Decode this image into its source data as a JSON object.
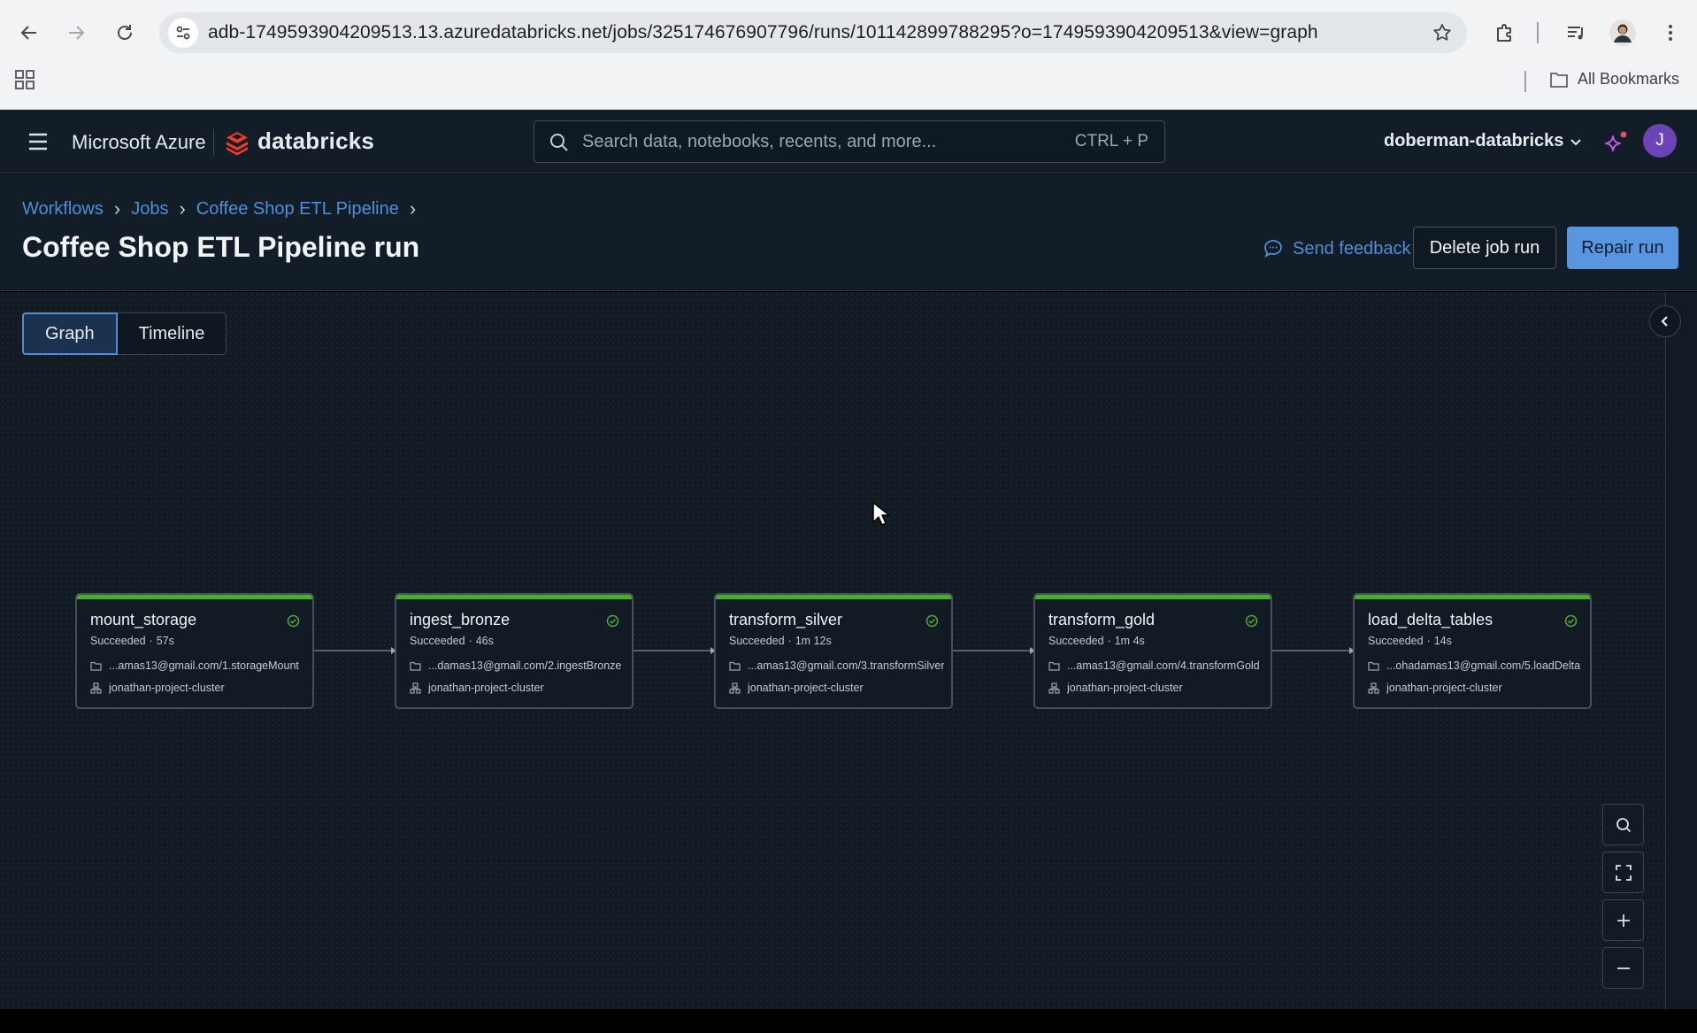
{
  "browser": {
    "url": "adb-1749593904209513.13.azuredatabricks.net/jobs/325174676907796/runs/101142899788295?o=1749593904209513&view=graph",
    "bookmarks_label": "All Bookmarks"
  },
  "header": {
    "brand": "Microsoft Azure",
    "product": "databricks",
    "search_placeholder": "Search data, notebooks, recents, and more...",
    "search_shortcut": "CTRL + P",
    "workspace": "doberman-databricks",
    "avatar_initial": "J"
  },
  "page": {
    "breadcrumbs": [
      "Workflows",
      "Jobs",
      "Coffee Shop ETL Pipeline"
    ],
    "title": "Coffee Shop ETL Pipeline run",
    "send_feedback": "Send feedback",
    "delete_button": "Delete job run",
    "repair_button": "Repair run"
  },
  "tabs": {
    "graph": "Graph",
    "timeline": "Timeline",
    "active": "graph"
  },
  "tasks": [
    {
      "name": "mount_storage",
      "status": "Succeeded",
      "duration": "57s",
      "path": "...amas13@gmail.com/1.storageMount",
      "cluster": "jonathan-project-cluster"
    },
    {
      "name": "ingest_bronze",
      "status": "Succeeded",
      "duration": "46s",
      "path": "...damas13@gmail.com/2.ingestBronze",
      "cluster": "jonathan-project-cluster"
    },
    {
      "name": "transform_silver",
      "status": "Succeeded",
      "duration": "1m 12s",
      "path": "...amas13@gmail.com/3.transformSilver",
      "cluster": "jonathan-project-cluster"
    },
    {
      "name": "transform_gold",
      "status": "Succeeded",
      "duration": "1m 4s",
      "path": "...amas13@gmail.com/4.transformGold",
      "cluster": "jonathan-project-cluster"
    },
    {
      "name": "load_delta_tables",
      "status": "Succeeded",
      "duration": "14s",
      "path": "...ohadamas13@gmail.com/5.loadDelta",
      "cluster": "jonathan-project-cluster"
    }
  ],
  "colors": {
    "success": "#4ea93b",
    "link": "#4f8fd9",
    "primary_button": "#5a95e0",
    "header_bg": "#121d27"
  },
  "icons": {
    "back": "arrow-left-icon",
    "forward": "arrow-right-icon",
    "reload": "reload-icon",
    "site_info": "tune-icon",
    "bookmark": "star-icon",
    "extensions": "puzzle-icon",
    "media": "media-control-icon",
    "menu": "kebab-icon",
    "task_status": "check-circle-icon",
    "notebook": "folder-icon",
    "cluster": "cluster-icon",
    "zoom_search": "search-icon",
    "fit": "fit-view-icon",
    "zoom_in": "plus-icon",
    "zoom_out": "minus-icon"
  }
}
